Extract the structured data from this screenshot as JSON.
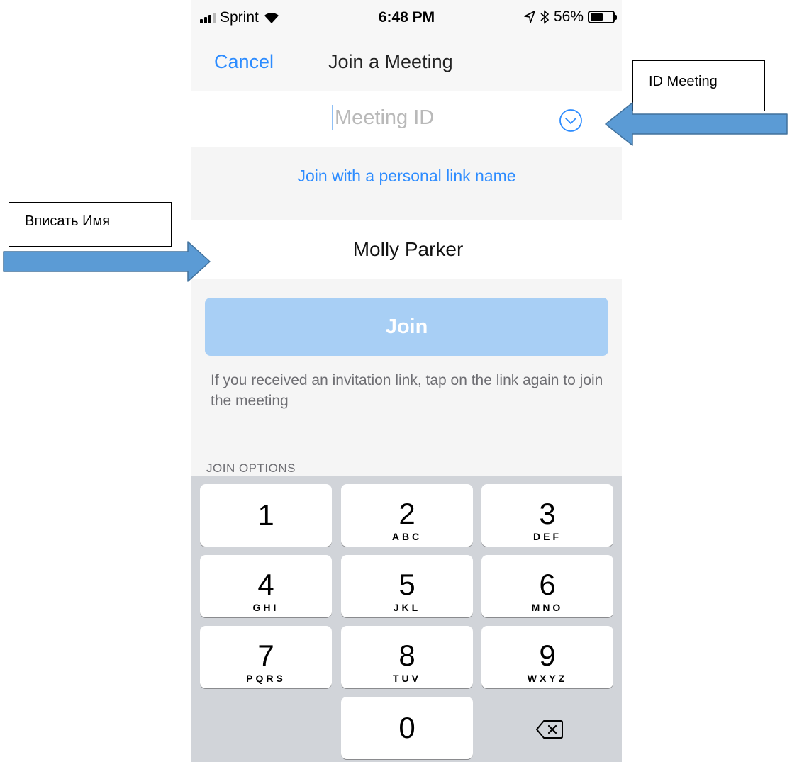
{
  "status_bar": {
    "carrier": "Sprint",
    "time": "6:48 PM",
    "battery_percent": "56%",
    "battery_level": 0.56
  },
  "nav": {
    "cancel_label": "Cancel",
    "title": "Join a Meeting"
  },
  "meeting_id": {
    "placeholder": "Meeting ID",
    "value": ""
  },
  "personal_link_label": "Join with a personal link name",
  "name_field": {
    "value": "Molly Parker"
  },
  "join_button_label": "Join",
  "hint_text": "If you received an invitation link, tap on the link again to join the meeting",
  "join_options_label": "JOIN OPTIONS",
  "keypad": {
    "keys": [
      {
        "num": "1",
        "letters": ""
      },
      {
        "num": "2",
        "letters": "ABC"
      },
      {
        "num": "3",
        "letters": "DEF"
      },
      {
        "num": "4",
        "letters": "GHI"
      },
      {
        "num": "5",
        "letters": "JKL"
      },
      {
        "num": "6",
        "letters": "MNO"
      },
      {
        "num": "7",
        "letters": "PQRS"
      },
      {
        "num": "8",
        "letters": "TUV"
      },
      {
        "num": "9",
        "letters": "WXYZ"
      },
      {
        "num": "0",
        "letters": ""
      }
    ]
  },
  "annotations": {
    "id_meeting": "ID Meeting",
    "enter_name": "Вписать Имя"
  },
  "colors": {
    "accent": "#2d8cff",
    "join_button": "#a8cff5",
    "keypad_bg": "#d1d4d9",
    "arrow": "#5b9bd5"
  }
}
